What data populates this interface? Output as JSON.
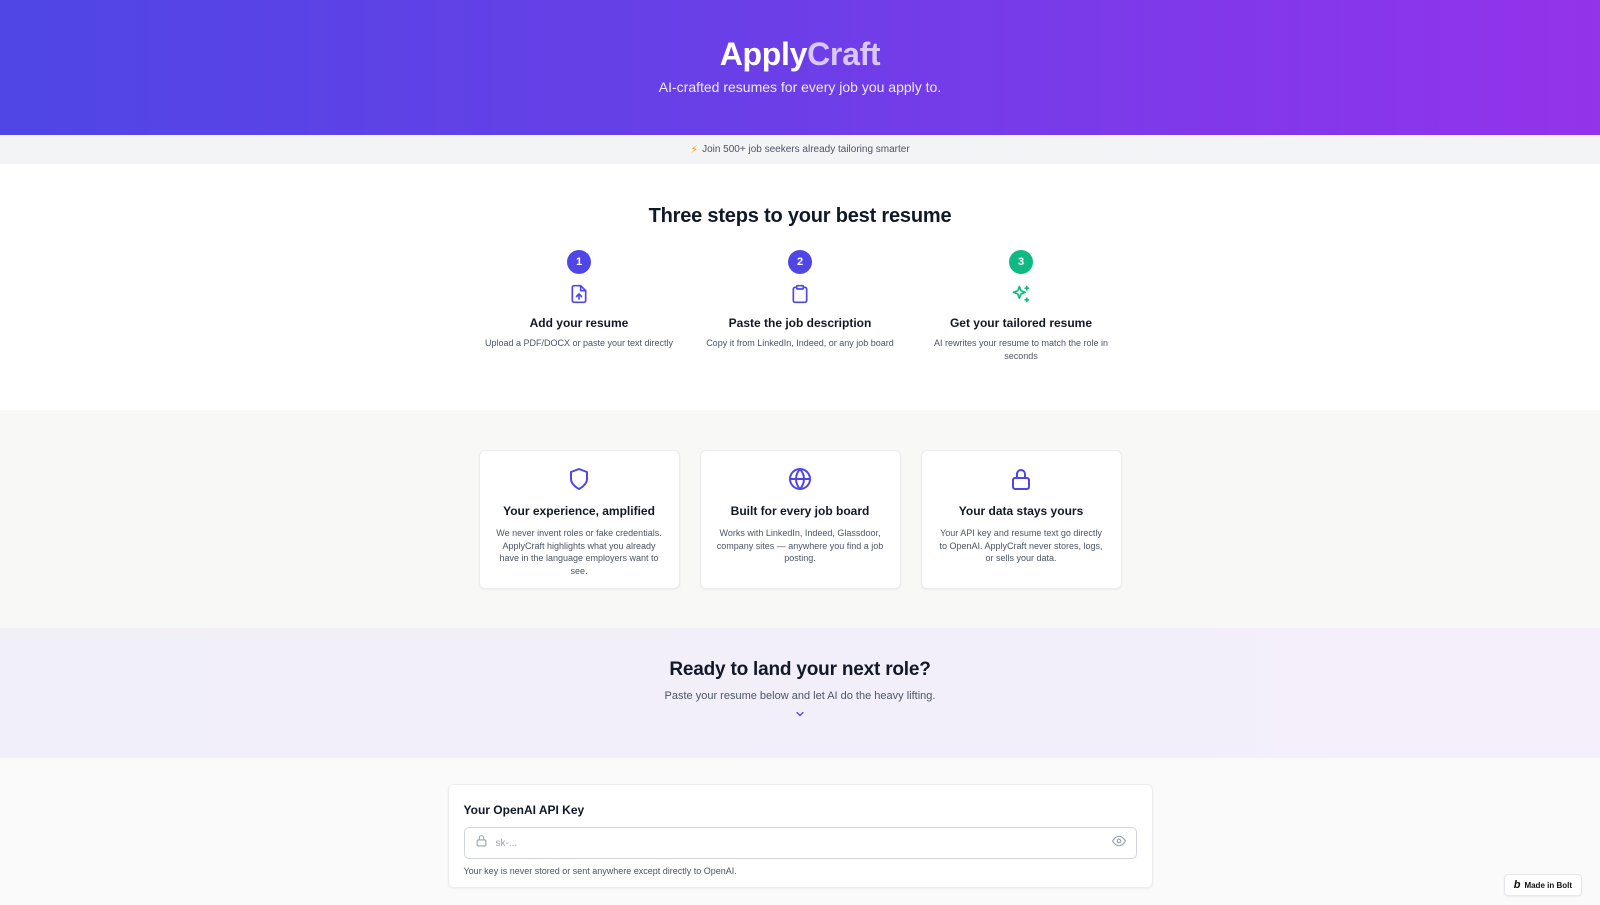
{
  "hero": {
    "brand_part1": "Apply",
    "brand_part2": "Craft",
    "tagline": "AI-crafted resumes for every job you apply to."
  },
  "social_proof": {
    "icon": "lightning-icon",
    "text": "Join 500+ job seekers already tailoring smarter"
  },
  "steps_section": {
    "heading": "Three steps to your best resume",
    "steps": [
      {
        "number": "1",
        "icon": "file-upload-icon",
        "title": "Add your resume",
        "description": "Upload a PDF/DOCX or paste your text directly"
      },
      {
        "number": "2",
        "icon": "clipboard-icon",
        "title": "Paste the job description",
        "description": "Copy it from LinkedIn, Indeed, or any job board"
      },
      {
        "number": "3",
        "icon": "sparkles-icon",
        "title": "Get your tailored resume",
        "description": "AI rewrites your resume to match the role in seconds"
      }
    ]
  },
  "features": [
    {
      "icon": "shield-icon",
      "title": "Your experience, amplified",
      "description": "We never invent roles or fake credentials. ApplyCraft highlights what you already have in the language employers want to see."
    },
    {
      "icon": "globe-icon",
      "title": "Built for every job board",
      "description": "Works with LinkedIn, Indeed, Glassdoor, company sites — anywhere you find a job posting."
    },
    {
      "icon": "lock-icon",
      "title": "Your data stays yours",
      "description": "Your API key and resume text go directly to OpenAI. ApplyCraft never stores, logs, or sells your data."
    }
  ],
  "cta": {
    "heading": "Ready to land your next role?",
    "subtext": "Paste your resume below and let AI do the heavy lifting."
  },
  "api_key_form": {
    "label": "Your OpenAI API Key",
    "placeholder": "sk-...",
    "value": "",
    "hint": "Your key is never stored or sent anywhere except directly to OpenAI."
  },
  "badge": {
    "logo": "b",
    "label": "Made in Bolt"
  },
  "colors": {
    "primary": "#4f46e5",
    "accent_purple": "#9333ea",
    "success": "#10b981"
  }
}
